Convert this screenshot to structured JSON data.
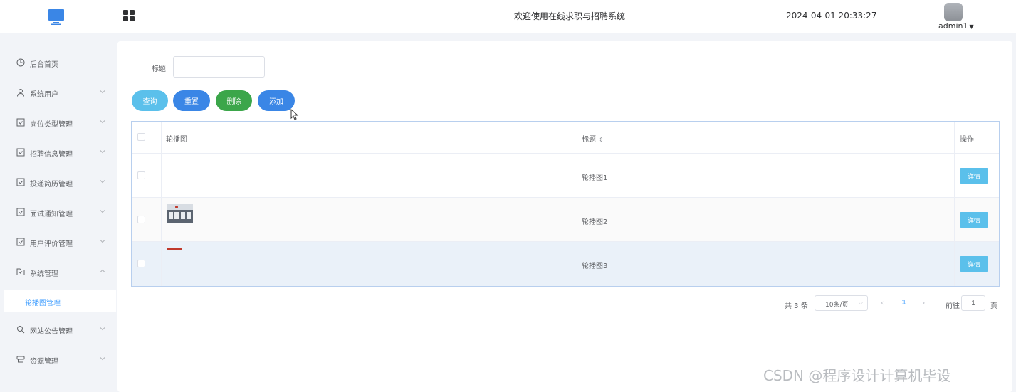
{
  "header": {
    "welcome": "欢迎使用在线求职与招聘系统",
    "datetime": "2024-04-01 20:33:27",
    "username": "admin1",
    "logo_icon": "monitor-icon",
    "menu_toggle_icon": "grid-icon"
  },
  "sidebar": {
    "items": [
      {
        "label": "后台首页",
        "icon": "clock-icon"
      },
      {
        "label": "系统用户",
        "icon": "user-icon"
      },
      {
        "label": "岗位类型管理",
        "icon": "checkbox-icon"
      },
      {
        "label": "招聘信息管理",
        "icon": "checkbox-icon"
      },
      {
        "label": "投递简历管理",
        "icon": "checkbox-icon"
      },
      {
        "label": "面试通知管理",
        "icon": "checkbox-icon"
      },
      {
        "label": "用户评价管理",
        "icon": "checkbox-icon"
      },
      {
        "label": "系统管理",
        "icon": "folder-icon"
      },
      {
        "label": "网站公告管理",
        "icon": "announcement-icon"
      },
      {
        "label": "资源管理",
        "icon": "resource-icon"
      }
    ],
    "active_sub": "轮播图管理"
  },
  "search": {
    "label": "标题",
    "value": ""
  },
  "toolbar": {
    "query": "查询",
    "reset": "重置",
    "delete": "删除",
    "add": "添加"
  },
  "table": {
    "headers": {
      "image": "轮播图",
      "title": "标题",
      "actions": "操作"
    },
    "rows": [
      {
        "title": "轮播图1",
        "action": "详情"
      },
      {
        "title": "轮播图2",
        "action": "详情"
      },
      {
        "title": "轮播图3",
        "action": "详情"
      }
    ]
  },
  "pagination": {
    "total": "共 3 条",
    "page_size": "10条/页",
    "current_page": "1",
    "goto_label": "前往",
    "goto_value": "1",
    "goto_suffix": "页"
  },
  "watermark": "CSDN @程序设计计算机毕设",
  "colors": {
    "primary": "#3a86e6",
    "info": "#5bc0eb",
    "success": "#3ba64a",
    "active_text": "#409eff"
  }
}
